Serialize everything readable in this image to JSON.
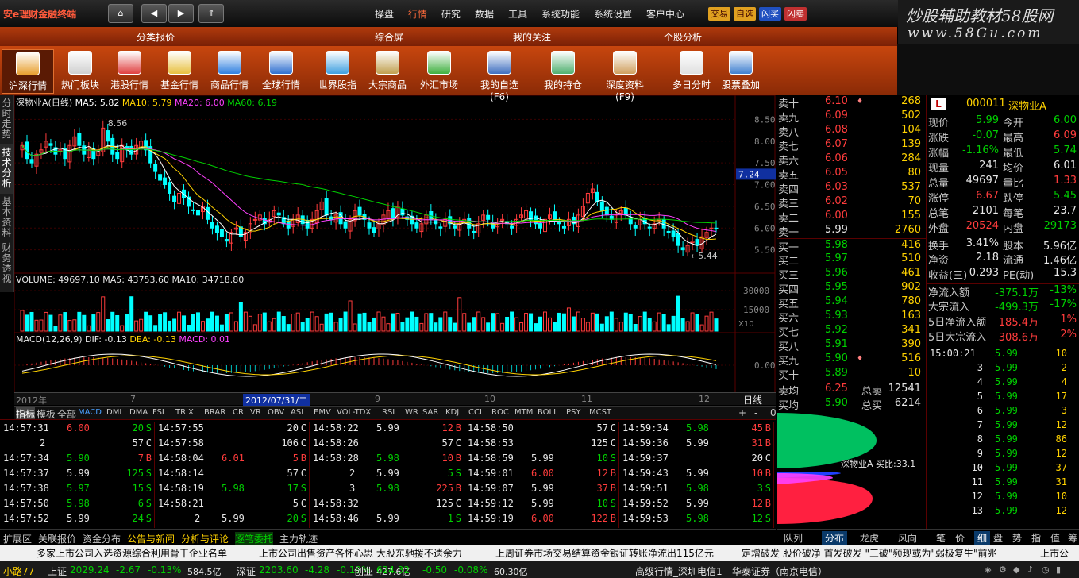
{
  "app": {
    "title": "安e理财金融终端"
  },
  "titlebar": {
    "nav_buttons": [
      "home-icon",
      "back-icon",
      "forward-icon",
      "up-icon"
    ],
    "menu": [
      "操盘",
      "行情",
      "研究",
      "数据",
      "工具",
      "系统功能",
      "系统设置",
      "客户中心"
    ],
    "active_menu": "行情",
    "quick": [
      "交易",
      "自选",
      "闪买",
      "闪卖"
    ],
    "ad": {
      "line1": "炒股辅助教材58股网",
      "line2": "www.58Gu.com"
    }
  },
  "categories": [
    "分类报价",
    "综合屏",
    "我的关注",
    "个股分析"
  ],
  "toolbar": [
    {
      "label": "沪深行情",
      "icon": "chart-icon",
      "color": "#e8a030",
      "selected": true
    },
    {
      "label": "热门板块",
      "icon": "fire-icon",
      "color": "#d0d0d0"
    },
    {
      "label": "港股行情",
      "icon": "hk-chart-icon",
      "color": "#e04040"
    },
    {
      "label": "基金行情",
      "icon": "fund-icon",
      "color": "#e8c040"
    },
    {
      "label": "商品行情",
      "icon": "commodity-icon",
      "color": "#3080e0"
    },
    {
      "label": "全球行情",
      "icon": "globe-icon",
      "color": "#3070d0"
    },
    {
      "label": "世界股指",
      "icon": "world-index-icon",
      "color": "#40a0e0"
    },
    {
      "label": "大宗商品",
      "icon": "bulk-goods-icon",
      "color": "#c0a050"
    },
    {
      "label": "外汇市场",
      "icon": "forex-icon",
      "color": "#40b040"
    },
    {
      "label": "我的自选(F6)",
      "icon": "user-icon",
      "color": "#4070c0"
    },
    {
      "label": "我的持仓",
      "icon": "holdings-icon",
      "color": "#50b070"
    },
    {
      "label": "深度资料(F9)",
      "icon": "document-icon",
      "color": "#d0a060"
    },
    {
      "label": "多日分时",
      "icon": "calendar-icon",
      "color": "#e0e0e0"
    },
    {
      "label": "股票叠加",
      "icon": "overlay-icon",
      "color": "#4080d0"
    }
  ],
  "vtabs": [
    "分时走势",
    "技术分析",
    "基本资料",
    "财务透视"
  ],
  "chart_data": [
    {
      "type": "candlestick",
      "title": "深物业A(日线)",
      "ma": [
        {
          "name": "MA5",
          "value": "5.82",
          "color": "#ffffff"
        },
        {
          "name": "MA10",
          "value": "5.79",
          "color": "#ffd200"
        },
        {
          "name": "MA20",
          "value": "6.00",
          "color": "#ff40ff"
        },
        {
          "name": "MA60",
          "value": "6.19",
          "color": "#00d000"
        }
      ],
      "ylim": [
        5.0,
        8.8
      ],
      "yticks": [
        "8.50",
        "8.00",
        "7.50",
        "7.00",
        "6.50",
        "6.00",
        "5.50"
      ],
      "marker_high": "8.56",
      "marker_low": "5.44",
      "current": "7.24",
      "closes": [
        7.9,
        7.6,
        7.5,
        7.7,
        7.8,
        8.0,
        7.9,
        7.7,
        7.8,
        7.6,
        7.9,
        8.1,
        7.9,
        7.7,
        7.8,
        7.6,
        7.8,
        8.3,
        8.0,
        7.7,
        7.6,
        7.9,
        7.8,
        7.7,
        7.9,
        8.0,
        7.8,
        7.5,
        7.3,
        7.1,
        7.0,
        6.8,
        6.6,
        6.8,
        6.7,
        6.5,
        6.4,
        6.3,
        6.5,
        6.2,
        6.0,
        5.9,
        5.8,
        5.7,
        5.9,
        6.0,
        5.8,
        5.9,
        6.1,
        6.2,
        6.3,
        6.1,
        6.2,
        6.4,
        6.3,
        6.1,
        6.0,
        6.2,
        6.3,
        6.1,
        6.0,
        6.2,
        6.4,
        6.6,
        6.3,
        6.2,
        6.3,
        6.1,
        6.0,
        6.2,
        6.4,
        6.3,
        6.2,
        6.0,
        5.9,
        6.1,
        6.3,
        6.4,
        6.2,
        6.5,
        6.3,
        6.2,
        6.1,
        6.0,
        6.1,
        6.3,
        6.2,
        6.1,
        6.0,
        6.2,
        6.1,
        6.0,
        6.1,
        6.2,
        6.0,
        5.9,
        6.1,
        6.3,
        6.2,
        6.0,
        6.1,
        6.2,
        6.1,
        6.0,
        6.2,
        6.3,
        6.4,
        6.2,
        6.1,
        6.0,
        6.2,
        6.3,
        6.2,
        6.1,
        6.0,
        6.2,
        6.1,
        6.3,
        6.5,
        6.8,
        6.9,
        6.6,
        6.4,
        6.3,
        6.2,
        6.3,
        6.4,
        6.3,
        6.1,
        6.0,
        6.2,
        6.1,
        6.0,
        6.1,
        6.2,
        6.0,
        5.9,
        5.8,
        5.6,
        5.5,
        5.6,
        5.7,
        5.6,
        5.8,
        5.9,
        6.0,
        5.99
      ]
    },
    {
      "type": "bar",
      "title": "VOLUME",
      "values_text": {
        "vol": "49697.10",
        "ma5": "43753.60",
        "ma10": "34718.80"
      },
      "yticks": [
        "30000",
        "15000"
      ],
      "unit": "X10"
    },
    {
      "type": "macd",
      "title": "MACD(12,26,9)",
      "dif": "-0.13",
      "dea": "-0.13",
      "macd": "0.01",
      "ytick": "0.00"
    }
  ],
  "dates": [
    "2012年",
    "7",
    "2012/07/31/二",
    "9",
    "10",
    "11",
    "12"
  ],
  "period": "日线",
  "indicators": [
    "指标",
    "模板",
    "全部",
    "MACD",
    "DMI",
    "DMA",
    "FSL",
    "TRIX",
    "BRAR",
    "CR",
    "VR",
    "OBV",
    "ASI",
    "EMV",
    "VOL-TDX",
    "RSI",
    "WR",
    "SAR",
    "KDJ",
    "CCI",
    "ROC",
    "MTM",
    "BOLL",
    "PSY",
    "MCST"
  ],
  "ind_ctrls": [
    "+",
    "-",
    "0"
  ],
  "orderbook": [
    {
      "l": "卖十",
      "p": "6.10",
      "v": "268",
      "mark": "♦"
    },
    {
      "l": "卖九",
      "p": "6.09",
      "v": "502"
    },
    {
      "l": "卖八",
      "p": "6.08",
      "v": "104"
    },
    {
      "l": "卖七",
      "p": "6.07",
      "v": "139"
    },
    {
      "l": "卖六",
      "p": "6.06",
      "v": "284"
    },
    {
      "l": "卖五",
      "p": "6.05",
      "v": "80"
    },
    {
      "l": "卖四",
      "p": "6.03",
      "v": "537"
    },
    {
      "l": "卖三",
      "p": "6.02",
      "v": "70"
    },
    {
      "l": "卖二",
      "p": "6.00",
      "v": "155"
    },
    {
      "l": "卖一",
      "p": "5.99",
      "v": "2760"
    },
    {
      "l": "买一",
      "p": "5.98",
      "v": "416"
    },
    {
      "l": "买二",
      "p": "5.97",
      "v": "510"
    },
    {
      "l": "买三",
      "p": "5.96",
      "v": "461"
    },
    {
      "l": "买四",
      "p": "5.95",
      "v": "902"
    },
    {
      "l": "买五",
      "p": "5.94",
      "v": "780"
    },
    {
      "l": "买六",
      "p": "5.93",
      "v": "163"
    },
    {
      "l": "买七",
      "p": "5.92",
      "v": "341"
    },
    {
      "l": "买八",
      "p": "5.91",
      "v": "390"
    },
    {
      "l": "买九",
      "p": "5.90",
      "v": "516",
      "mark": "♦"
    },
    {
      "l": "买十",
      "p": "5.89",
      "v": "10"
    }
  ],
  "order_summary": [
    {
      "l": "卖均",
      "p": "6.25",
      "k": "总卖",
      "v": "12541"
    },
    {
      "l": "买均",
      "p": "5.90",
      "k": "总买",
      "v": "6214"
    }
  ],
  "stock": {
    "badge": "L",
    "code": "000011",
    "name": "深物业A"
  },
  "quote": [
    [
      "现价",
      "5.99",
      "今开",
      "6.00"
    ],
    [
      "涨跌",
      "-0.07",
      "最高",
      "6.09"
    ],
    [
      "涨幅",
      "-1.16%",
      "最低",
      "5.74"
    ],
    [
      "现量",
      "241",
      "均价",
      "6.01"
    ],
    [
      "总量",
      "49697",
      "量比",
      "1.33"
    ],
    [
      "涨停",
      "6.67",
      "跌停",
      "5.45"
    ],
    [
      "总笔",
      "2101",
      "每笔",
      "23.7"
    ],
    [
      "外盘",
      "20524",
      "内盘",
      "29173"
    ],
    [
      "换手",
      "3.41%",
      "股本",
      "5.96亿"
    ],
    [
      "净资",
      "2.18",
      "流通",
      "1.46亿"
    ],
    [
      "收益(三)",
      "0.293",
      "PE(动)",
      "15.3"
    ],
    [
      "净流入额",
      "-375.1万",
      "",
      "-13%"
    ],
    [
      "大宗流入",
      "-499.3万",
      "",
      "-17%"
    ],
    [
      "5日净流入额",
      "185.4万",
      "",
      "1%"
    ],
    [
      "5日大宗流入",
      "308.6万",
      "",
      "2%"
    ]
  ],
  "ticklist": [
    [
      "15:00:21",
      "5.99",
      "10"
    ],
    [
      "3",
      "5.99",
      "2"
    ],
    [
      "4",
      "5.99",
      "4"
    ],
    [
      "5",
      "5.99",
      "17"
    ],
    [
      "6",
      "5.99",
      "3"
    ],
    [
      "7",
      "5.99",
      "12"
    ],
    [
      "8",
      "5.99",
      "86"
    ],
    [
      "9",
      "5.99",
      "12"
    ],
    [
      "10",
      "5.99",
      "37"
    ],
    [
      "11",
      "5.99",
      "31"
    ],
    [
      "12",
      "5.99",
      "10"
    ],
    [
      "13",
      "5.99",
      "12"
    ]
  ],
  "dist": {
    "label": "深物业A 买比:33.1"
  },
  "ticks": [
    [
      [
        "14:57:31",
        "6.00",
        "20",
        "S"
      ],
      [
        "2",
        "",
        "57",
        "C"
      ],
      [
        "14:57:34",
        "5.90",
        "7",
        "B"
      ],
      [
        "14:57:37",
        "5.99",
        "125",
        "S"
      ],
      [
        "14:57:38",
        "5.97",
        "15",
        "S"
      ],
      [
        "14:57:50",
        "5.98",
        "6",
        "S"
      ],
      [
        "14:57:52",
        "5.99",
        "24",
        "S"
      ]
    ],
    [
      [
        "14:57:55",
        "",
        "20",
        "C"
      ],
      [
        "14:57:58",
        "",
        "106",
        "C"
      ],
      [
        "14:58:04",
        "6.01",
        "5",
        "B"
      ],
      [
        "14:58:14",
        "",
        "57",
        "C"
      ],
      [
        "14:58:19",
        "5.98",
        "17",
        "S"
      ],
      [
        "14:58:21",
        "",
        "5",
        "C"
      ],
      [
        "2",
        "5.99",
        "20",
        "S"
      ]
    ],
    [
      [
        "14:58:22",
        "5.99",
        "12",
        "B"
      ],
      [
        "14:58:26",
        "",
        "57",
        "C"
      ],
      [
        "14:58:28",
        "5.98",
        "10",
        "B"
      ],
      [
        "2",
        "5.99",
        "5",
        "S"
      ],
      [
        "3",
        "5.98",
        "225",
        "B"
      ],
      [
        "14:58:32",
        "",
        "125",
        "C"
      ],
      [
        "14:58:46",
        "5.99",
        "1",
        "S"
      ]
    ],
    [
      [
        "14:58:50",
        "",
        "57",
        "C"
      ],
      [
        "14:58:53",
        "",
        "125",
        "C"
      ],
      [
        "14:58:59",
        "5.99",
        "10",
        "S"
      ],
      [
        "14:59:01",
        "6.00",
        "12",
        "B"
      ],
      [
        "14:59:07",
        "5.99",
        "37",
        "B"
      ],
      [
        "14:59:12",
        "5.99",
        "10",
        "S"
      ],
      [
        "14:59:19",
        "6.00",
        "122",
        "B"
      ]
    ],
    [
      [
        "14:59:34",
        "5.98",
        "45",
        "B"
      ],
      [
        "14:59:36",
        "5.99",
        "31",
        "B"
      ],
      [
        "14:59:37",
        "",
        "20",
        "C"
      ],
      [
        "14:59:43",
        "5.99",
        "10",
        "B"
      ],
      [
        "14:59:51",
        "5.98",
        "3",
        "S"
      ],
      [
        "14:59:52",
        "5.99",
        "12",
        "B"
      ],
      [
        "14:59:53",
        "5.98",
        "12",
        "S"
      ]
    ]
  ],
  "botnav": [
    "扩展区",
    "关联报价",
    "资金分布",
    "公告与新闻",
    "分析与评论",
    "逐笔委托",
    "主力轨迹"
  ],
  "rtabs": [
    "队列",
    "分布",
    "龙虎",
    "风向",
    "笔",
    "价",
    "细",
    "盘",
    "势",
    "指",
    "值",
    "筹"
  ],
  "scroll": [
    "多家上市公司入选资源综合利用骨干企业名单",
    "上市公司出售资产各怀心思 大股东驰援不遗余力",
    "上周证券市场交易结算资金银证转账净流出115亿元",
    "定增破发 股价破净 首发破发 \"三破\"频现或为\"弱极复生\"前兆",
    "上市公"
  ],
  "status": {
    "brand": "小路77",
    "idx": [
      {
        "n": "上证",
        "v": "2029.24",
        "c": "-2.67",
        "p": "-0.13%",
        "a": "584.5亿"
      },
      {
        "n": "深证",
        "v": "2203.60",
        "c": "-4.28",
        "p": "-0.19%",
        "a": "427.6亿"
      },
      {
        "n": "创业",
        "v": "624.32",
        "c": "-0.50",
        "p": "-0.08%",
        "a": "60.30亿"
      }
    ],
    "feed": "高级行情_深圳电信1",
    "broker": "华泰证券（南京电信）"
  }
}
